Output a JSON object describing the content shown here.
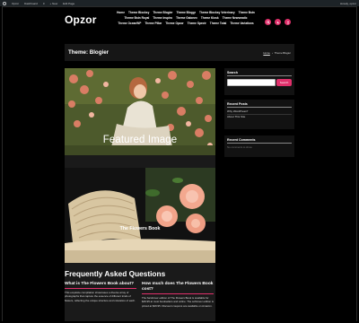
{
  "admin_bar": {
    "items": [
      "Opzor",
      "Dashboard",
      "0",
      "+ New",
      "Edit Page"
    ],
    "greeting": "Howdy, opzor"
  },
  "header": {
    "logo": "Opzor",
    "nav": [
      "Home",
      "Theme Blocksy",
      "Theme Blogier",
      "Theme Bloggr",
      "Theme Blocksy Veterinary",
      "Theme Bstn",
      "Theme Bstn Royal",
      "Theme Inspiro",
      "Theme Galonex",
      "Theme Kiosk",
      "Theme Newsmatic",
      "Theme OceanWP",
      "Theme Pillar",
      "Theme Opzor",
      "Theme Spectr",
      "Theme Total",
      "Theme Variations"
    ]
  },
  "title_bar": {
    "title": "Theme: Blogier",
    "crumb_home": "Home",
    "crumb_sep": "›",
    "crumb_current": "Theme Blogier"
  },
  "main": {
    "featured_label": "Featured Image",
    "post_title": "The Flowers Book",
    "faq_title": "Frequently Asked Questions",
    "faq": [
      {
        "question": "What is The Flowers Book about?",
        "answer": "This exquisite compilation showcases a diverse array of photographs that capture the essence of different kinds of flowers, reflecting the unique structure and coloration of each."
      },
      {
        "question": "How much does The Flowers Book cost?",
        "answer": "The hardcover edition of The Flowers Book is available for $49.95 at most booksellers and online. The softcover edition is priced at $29.95. Discount coupons are available on Amazon."
      }
    ]
  },
  "sidebar": {
    "search_title": "Search",
    "search_button": "Search",
    "search_placeholder": "",
    "recent_posts_title": "Recent Posts",
    "recent_posts": [
      "Why WordPress?",
      "About This Site"
    ],
    "recent_comments_title": "Recent Comments",
    "no_comments": "No comments to show."
  },
  "colors": {
    "accent": "#e0306b",
    "background": "#000000",
    "panel": "#161616"
  }
}
